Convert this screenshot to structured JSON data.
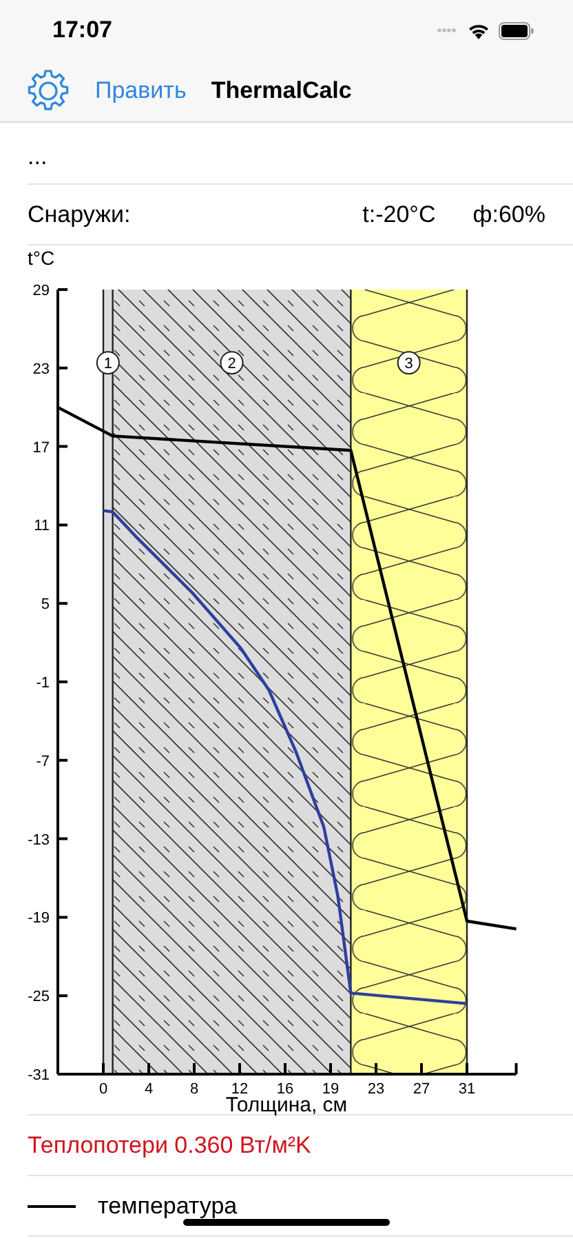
{
  "status_bar": {
    "time": "17:07"
  },
  "nav_bar": {
    "edit_button": "Править",
    "title": "ThermalCalc"
  },
  "rows": [
    {
      "kind": "text",
      "text": "..."
    },
    {
      "kind": "climate",
      "label": "Снаружи:",
      "temperature": "t:-20°C",
      "humidity": "ф:60%"
    }
  ],
  "chart": {
    "layers": [
      {
        "label": "1",
        "kind": "plaster"
      },
      {
        "label": "2",
        "kind": "concrete"
      },
      {
        "label": "3",
        "kind": "insulation"
      }
    ],
    "chart_data": {
      "type": "line",
      "xlabel": "Толщина, см",
      "ylabel": "t°C",
      "x": [
        -3.9,
        0,
        0.8,
        2.9,
        7.6,
        11.7,
        14.1,
        16.4,
        18.8,
        20,
        21.1,
        31,
        35.2
      ],
      "series": [
        {
          "name": "температура",
          "color": "#000000",
          "values": [
            20.0,
            null,
            17.8,
            null,
            null,
            null,
            null,
            null,
            null,
            null,
            16.7,
            -19.3,
            -19.9
          ]
        },
        {
          "color": "#2e3f9e",
          "values": [
            null,
            12.1,
            12.0,
            10,
            5.8,
            1.6,
            -1.6,
            -6.3,
            -12.1,
            -17.4,
            -24.8,
            -25.6,
            null
          ]
        }
      ],
      "xlim": [
        -3.9,
        35.2
      ],
      "ylim": [
        -31,
        29
      ],
      "xticks": [
        {
          "value": 0,
          "label": "0"
        },
        {
          "value": 3.875,
          "label": "4"
        },
        {
          "value": 7.75,
          "label": "8"
        },
        {
          "value": 11.625,
          "label": "12"
        },
        {
          "value": 15.5,
          "label": "16"
        },
        {
          "value": 19.375,
          "label": "19"
        },
        {
          "value": 23.25,
          "label": "23"
        },
        {
          "value": 27.125,
          "label": "27"
        },
        {
          "value": 31,
          "label": "31"
        }
      ],
      "yticks": [
        29,
        23,
        17,
        11,
        5,
        -1,
        -7,
        -13,
        -19,
        -25,
        -31
      ],
      "ref_lines": [
        {
          "axis": "x",
          "value": 0
        },
        {
          "axis": "x",
          "value": 0.8
        },
        {
          "axis": "x",
          "value": 21.1
        },
        {
          "axis": "x",
          "value": 31
        }
      ]
    }
  },
  "result": {
    "text": "Теплопотери 0.360 Вт/м²K"
  }
}
